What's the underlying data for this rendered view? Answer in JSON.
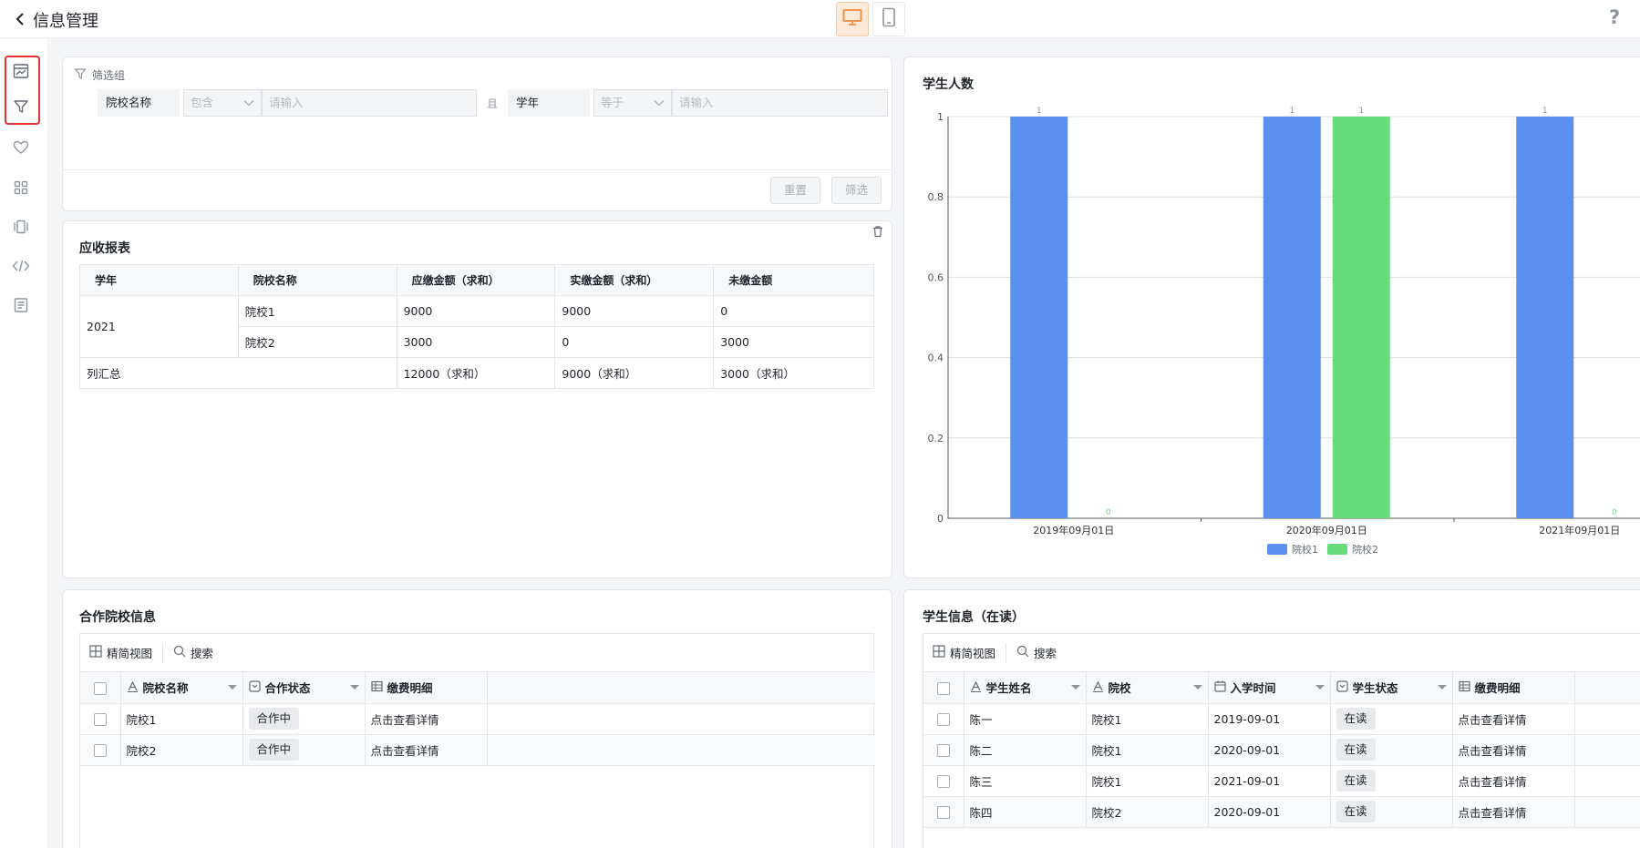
{
  "header": {
    "title": "信息管理",
    "back_icon": "chevron-left-icon",
    "view_modes": [
      "desktop-icon",
      "tablet-icon"
    ],
    "help_label": "?"
  },
  "rail": {
    "icons": [
      "chart-icon",
      "filter-icon",
      "heart-icon",
      "grid-icon",
      "carousel-icon",
      "code-icon",
      "form-icon"
    ],
    "highlight_color": "#e63232"
  },
  "filter_panel": {
    "group_label": "筛选组",
    "condition1": {
      "field": "院校名称",
      "operator": "包含",
      "placeholder": "请输入"
    },
    "conjunction": "且",
    "condition2": {
      "field": "学年",
      "operator": "等于",
      "placeholder": "请输入"
    },
    "reset_label": "重置",
    "submit_label": "筛选"
  },
  "receivable_report": {
    "title": "应收报表",
    "headers": [
      "学年",
      "院校名称",
      "应缴金额（求和）",
      "实缴金额（求和）",
      "未缴金额"
    ],
    "year": "2021",
    "rows": [
      {
        "school": "院校1",
        "due": "9000",
        "paid": "9000",
        "unpaid": "0"
      },
      {
        "school": "院校2",
        "due": "3000",
        "paid": "0",
        "unpaid": "3000"
      }
    ],
    "total_label": "列汇总",
    "totals": {
      "due": "12000（求和）",
      "paid": "9000（求和）",
      "unpaid": "3000（求和）"
    }
  },
  "chart_data": {
    "type": "bar",
    "title": "学生人数",
    "categories": [
      "2019年09月01日",
      "2020年09月01日",
      "2021年09月01日"
    ],
    "series": [
      {
        "name": "院校1",
        "color": "#5b8ff0",
        "values": [
          1,
          1,
          1
        ]
      },
      {
        "name": "院校2",
        "color": "#66dd7a",
        "values": [
          0,
          1,
          0
        ]
      }
    ],
    "ylim": [
      0,
      1
    ],
    "yticks": [
      "0",
      "0.2",
      "0.4",
      "0.6",
      "0.8",
      "1"
    ],
    "grid": true,
    "legend": "bottom"
  },
  "partners": {
    "title": "合作院校信息",
    "toolbar": {
      "view_label": "精简视图",
      "search_label": "搜索"
    },
    "columns": [
      {
        "label": "院校名称",
        "icon": "text-type-icon"
      },
      {
        "label": "合作状态",
        "icon": "select-type-icon"
      },
      {
        "label": "缴费明细",
        "icon": "table-type-icon"
      }
    ],
    "rows": [
      {
        "name": "院校1",
        "status": "合作中",
        "detail": "点击查看详情"
      },
      {
        "name": "院校2",
        "status": "合作中",
        "detail": "点击查看详情"
      }
    ]
  },
  "students": {
    "title": "学生信息（在读）",
    "toolbar": {
      "view_label": "精简视图",
      "search_label": "搜索"
    },
    "columns": [
      {
        "label": "学生姓名",
        "icon": "text-type-icon"
      },
      {
        "label": "院校",
        "icon": "text-type-icon"
      },
      {
        "label": "入学时间",
        "icon": "date-type-icon"
      },
      {
        "label": "学生状态",
        "icon": "select-type-icon"
      },
      {
        "label": "缴费明细",
        "icon": "table-type-icon"
      }
    ],
    "rows": [
      {
        "name": "陈一",
        "school": "院校1",
        "date": "2019-09-01",
        "status": "在读",
        "detail": "点击查看详情"
      },
      {
        "name": "陈二",
        "school": "院校1",
        "date": "2020-09-01",
        "status": "在读",
        "detail": "点击查看详情"
      },
      {
        "name": "陈三",
        "school": "院校1",
        "date": "2021-09-01",
        "status": "在读",
        "detail": "点击查看详情"
      },
      {
        "name": "陈四",
        "school": "院校2",
        "date": "2020-09-01",
        "status": "在读",
        "detail": "点击查看详情"
      }
    ]
  }
}
